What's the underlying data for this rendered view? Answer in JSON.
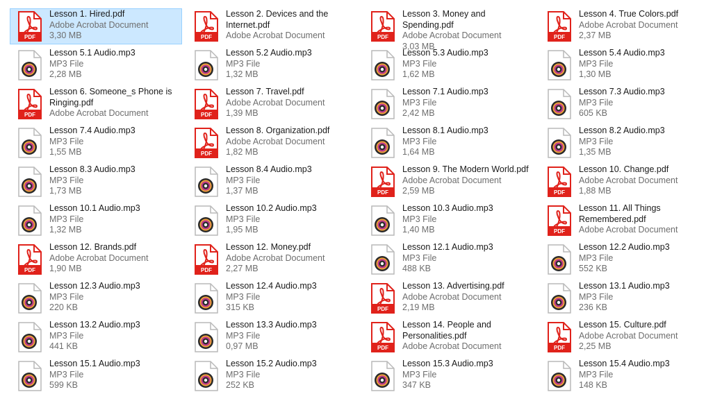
{
  "items": [
    {
      "name": "Lesson 1. Hired.pdf",
      "type": "Adobe Acrobat Document",
      "size": "3,30 MB",
      "kind": "pdf",
      "selected": true
    },
    {
      "name": "Lesson 2. Devices and the Internet.pdf",
      "type": "Adobe Acrobat Document",
      "size": "",
      "kind": "pdf"
    },
    {
      "name": "Lesson 3. Money and Spending.pdf",
      "type": "Adobe Acrobat Document",
      "size": "3,03 MB",
      "kind": "pdf"
    },
    {
      "name": "Lesson 4. True Colors.pdf",
      "type": "Adobe Acrobat Document",
      "size": "2,37 MB",
      "kind": "pdf"
    },
    {
      "name": "Lesson 5.1 Audio.mp3",
      "type": "MP3 File",
      "size": "2,28 MB",
      "kind": "mp3"
    },
    {
      "name": "Lesson 5.2 Audio.mp3",
      "type": "MP3 File",
      "size": "1,32 MB",
      "kind": "mp3"
    },
    {
      "name": "Lesson 5.3 Audio.mp3",
      "type": "MP3 File",
      "size": "1,62 MB",
      "kind": "mp3"
    },
    {
      "name": "Lesson 5.4 Audio.mp3",
      "type": "MP3 File",
      "size": "1,30 MB",
      "kind": "mp3"
    },
    {
      "name": "Lesson 6. Someone_s Phone is Ringing.pdf",
      "type": "Adobe Acrobat Document",
      "size": "",
      "kind": "pdf"
    },
    {
      "name": "Lesson 7. Travel.pdf",
      "type": "Adobe Acrobat Document",
      "size": "1,39 MB",
      "kind": "pdf"
    },
    {
      "name": "Lesson 7.1 Audio.mp3",
      "type": "MP3 File",
      "size": "2,42 MB",
      "kind": "mp3"
    },
    {
      "name": "Lesson 7.3 Audio.mp3",
      "type": "MP3 File",
      "size": "605 KB",
      "kind": "mp3"
    },
    {
      "name": "Lesson 7.4 Audio.mp3",
      "type": "MP3 File",
      "size": "1,55 MB",
      "kind": "mp3"
    },
    {
      "name": "Lesson 8. Organization.pdf",
      "type": "Adobe Acrobat Document",
      "size": "1,82 MB",
      "kind": "pdf"
    },
    {
      "name": "Lesson 8.1 Audio.mp3",
      "type": "MP3 File",
      "size": "1,64 MB",
      "kind": "mp3"
    },
    {
      "name": "Lesson 8.2 Audio.mp3",
      "type": "MP3 File",
      "size": "1,35 MB",
      "kind": "mp3"
    },
    {
      "name": "Lesson 8.3 Audio.mp3",
      "type": "MP3 File",
      "size": "1,73 MB",
      "kind": "mp3"
    },
    {
      "name": "Lesson 8.4 Audio.mp3",
      "type": "MP3 File",
      "size": "1,37 MB",
      "kind": "mp3"
    },
    {
      "name": "Lesson 9. The Modern World.pdf",
      "type": "Adobe Acrobat Document",
      "size": "2,59 MB",
      "kind": "pdf"
    },
    {
      "name": "Lesson 10. Change.pdf",
      "type": "Adobe Acrobat Document",
      "size": "1,88 MB",
      "kind": "pdf"
    },
    {
      "name": "Lesson 10.1 Audio.mp3",
      "type": "MP3 File",
      "size": "1,32 MB",
      "kind": "mp3"
    },
    {
      "name": "Lesson 10.2 Audio.mp3",
      "type": "MP3 File",
      "size": "1,95 MB",
      "kind": "mp3"
    },
    {
      "name": "Lesson 10.3 Audio.mp3",
      "type": "MP3 File",
      "size": "1,40 MB",
      "kind": "mp3"
    },
    {
      "name": "Lesson 11. All Things Remembered.pdf",
      "type": "Adobe Acrobat Document",
      "size": "",
      "kind": "pdf"
    },
    {
      "name": "Lesson 12. Brands.pdf",
      "type": "Adobe Acrobat Document",
      "size": "1,90 MB",
      "kind": "pdf"
    },
    {
      "name": "Lesson 12. Money.pdf",
      "type": "Adobe Acrobat Document",
      "size": "2,27 MB",
      "kind": "pdf"
    },
    {
      "name": "Lesson 12.1 Audio.mp3",
      "type": "MP3 File",
      "size": "488 KB",
      "kind": "mp3"
    },
    {
      "name": "Lesson 12.2 Audio.mp3",
      "type": "MP3 File",
      "size": "552 KB",
      "kind": "mp3"
    },
    {
      "name": "Lesson 12.3 Audio.mp3",
      "type": "MP3 File",
      "size": "220 KB",
      "kind": "mp3"
    },
    {
      "name": "Lesson 12.4 Audio.mp3",
      "type": "MP3 File",
      "size": "315 KB",
      "kind": "mp3"
    },
    {
      "name": "Lesson 13. Advertising.pdf",
      "type": "Adobe Acrobat Document",
      "size": "2,19 MB",
      "kind": "pdf"
    },
    {
      "name": "Lesson 13.1 Audio.mp3",
      "type": "MP3 File",
      "size": "236 KB",
      "kind": "mp3"
    },
    {
      "name": "Lesson 13.2 Audio.mp3",
      "type": "MP3 File",
      "size": "441 KB",
      "kind": "mp3"
    },
    {
      "name": "Lesson 13.3 Audio.mp3",
      "type": "MP3 File",
      "size": "0,97 MB",
      "kind": "mp3"
    },
    {
      "name": "Lesson 14. People and Personalities.pdf",
      "type": "Adobe Acrobat Document",
      "size": "",
      "kind": "pdf"
    },
    {
      "name": "Lesson 15. Culture.pdf",
      "type": "Adobe Acrobat Document",
      "size": "2,25 MB",
      "kind": "pdf"
    },
    {
      "name": "Lesson 15.1 Audio.mp3",
      "type": "MP3 File",
      "size": "599 KB",
      "kind": "mp3"
    },
    {
      "name": "Lesson 15.2 Audio.mp3",
      "type": "MP3 File",
      "size": "252 KB",
      "kind": "mp3"
    },
    {
      "name": "Lesson 15.3 Audio.mp3",
      "type": "MP3 File",
      "size": "347 KB",
      "kind": "mp3"
    },
    {
      "name": "Lesson 15.4 Audio.mp3",
      "type": "MP3 File",
      "size": "148 KB",
      "kind": "mp3"
    }
  ],
  "icon_labels": {
    "pdf": "PDF"
  },
  "colors": {
    "pdf_red": "#e0221b",
    "selection_bg": "#cce8ff",
    "selection_border": "#99d1ff",
    "secondary_text": "#6e6e6e"
  }
}
